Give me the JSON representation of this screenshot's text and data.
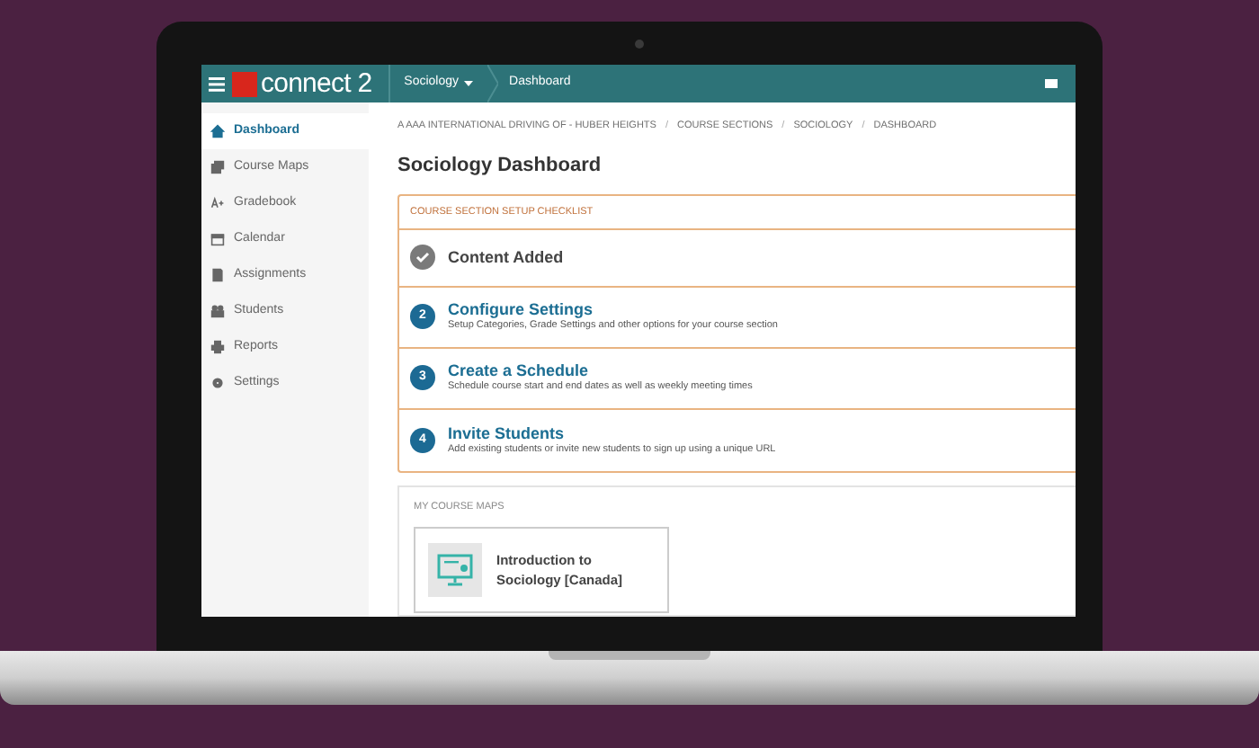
{
  "topbar": {
    "brand": "connect 2",
    "course_menu": "Sociology",
    "current_page": "Dashboard"
  },
  "sidebar": {
    "items": [
      {
        "label": "Dashboard",
        "selected": true
      },
      {
        "label": "Course Maps",
        "selected": false
      },
      {
        "label": "Gradebook",
        "selected": false
      },
      {
        "label": "Calendar",
        "selected": false
      },
      {
        "label": "Assignments",
        "selected": false
      },
      {
        "label": "Students",
        "selected": false
      },
      {
        "label": "Reports",
        "selected": false
      },
      {
        "label": "Settings",
        "selected": false
      }
    ]
  },
  "breadcrumb": [
    {
      "kind": "link",
      "text": "A AAA INTERNATIONAL DRIVING OF - HUBER HEIGHTS"
    },
    {
      "kind": "separator",
      "text": "/"
    },
    {
      "kind": "link",
      "text": "COURSE SECTIONS"
    },
    {
      "kind": "separator",
      "text": "/"
    },
    {
      "kind": "link",
      "text": "SOCIOLOGY"
    },
    {
      "kind": "separator",
      "text": "/"
    },
    {
      "kind": "link",
      "text": "DASHBOARD"
    }
  ],
  "title": "Sociology Dashboard",
  "checklist": {
    "heading": "COURSE SECTION SETUP CHECKLIST",
    "steps": [
      {
        "kind": "done",
        "title": "Content Added"
      },
      {
        "kind": "todo",
        "number": "2",
        "title": "Configure Settings",
        "description": "Setup Categories, Grade Settings and other options for your course section"
      },
      {
        "kind": "todo",
        "number": "3",
        "title": "Create a Schedule",
        "description": "Schedule course start and end dates as well as weekly meeting times"
      },
      {
        "kind": "todo",
        "number": "4",
        "title": "Invite Students",
        "description": "Add existing students or invite new students to sign up using a unique URL"
      }
    ]
  },
  "course_maps": {
    "heading": "MY COURSE MAPS",
    "cards": [
      {
        "title": "Introduction to Sociology [Canada]"
      }
    ]
  }
}
